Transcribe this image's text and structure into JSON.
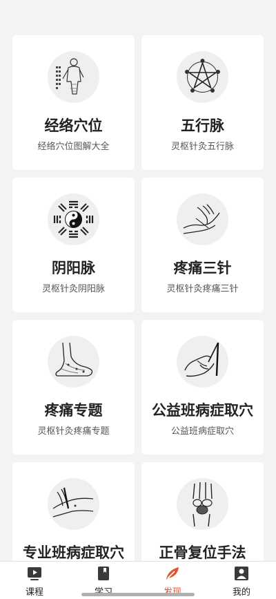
{
  "cards": [
    {
      "title": "经络穴位",
      "subtitle": "经络穴位图解大全",
      "icon": "meridian-figure-icon"
    },
    {
      "title": "五行脉",
      "subtitle": "灵枢针灸五行脉",
      "icon": "five-elements-star-icon"
    },
    {
      "title": "阴阳脉",
      "subtitle": "灵枢针灸阴阳脉",
      "icon": "yin-yang-bagua-icon"
    },
    {
      "title": "疼痛三针",
      "subtitle": "灵枢针灸疼痛三针",
      "icon": "hand-needle-icon"
    },
    {
      "title": "疼痛专题",
      "subtitle": "灵枢针灸疼痛专题",
      "icon": "foot-icon"
    },
    {
      "title": "公益班病症取穴",
      "subtitle": "公益班病症取穴",
      "icon": "hand-pinch-icon"
    },
    {
      "title": "专业班病症取穴",
      "subtitle": "",
      "icon": "arm-needle-icon"
    },
    {
      "title": "正骨复位手法",
      "subtitle": "",
      "icon": "wrist-bones-icon"
    }
  ],
  "tabs": [
    {
      "label": "课程",
      "icon": "course-video-icon",
      "active": false
    },
    {
      "label": "学习",
      "icon": "study-book-icon",
      "active": false
    },
    {
      "label": "发现",
      "icon": "discover-leaf-icon",
      "active": true
    },
    {
      "label": "我的",
      "icon": "profile-icon",
      "active": false
    }
  ],
  "colors": {
    "accent": "#e4532c",
    "background": "#f3f3f3",
    "card": "#ffffff"
  }
}
